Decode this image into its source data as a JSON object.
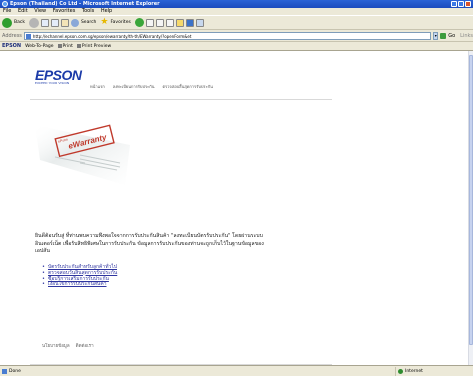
{
  "window": {
    "title": "Epson (Thailand) Co Ltd - Microsoft Internet Explorer"
  },
  "menu": [
    "File",
    "Edit",
    "View",
    "Favorites",
    "Tools",
    "Help"
  ],
  "toolbar": {
    "back_label": "Back",
    "search_label": "Search",
    "favorites_label": "Favorites"
  },
  "address": {
    "label": "Address",
    "url": "http://echannel.epson.com.sg/epson/ewarranty/th-th/EWarranty/?openForm&et",
    "go_label": "Go",
    "links_label": "Links"
  },
  "links_bar": {
    "brand": "EPSON",
    "web_to_page": "Web-To-Page",
    "print": "Print",
    "print_preview": "Print Preview"
  },
  "page": {
    "logo": "EPSON",
    "tagline": "EXCEED YOUR VISION",
    "nav": [
      "หน้าแรก",
      "ลงทะเบียนการรับประกัน",
      "ตรวจสอบสิ้นสุดการรับประกัน"
    ],
    "warranty_stamp": "ePson eWarranty",
    "intro": "ยินดีต้อนรับสู่ ที่ท่านพบความพึงพอใจจากการรับประกันสินค้า \"ลงทะเบียนบัตรรับประกัน\" โดยผ่านระบบอินเตอร์เน็ต เพื่อรับสิทธิพิเศษในการรับประกัน ข้อมูลการรับประกันของท่านจะถูกเก็บไว้ในฐานข้อมูลของเอปสัน",
    "links": [
      "บัตรรับประกันสำหรับลูกค้าทั่วไป",
      "ตรวจสอบวันสิ้นสุดการรับประกัน",
      "ซื้อบริการเสริมการรับประกัน",
      "เงื่อนไขการรับประกันสินค้า"
    ],
    "footer_nav": [
      "นโยบายข้อมูล",
      "ติดต่อเรา"
    ]
  },
  "status": {
    "text": "Done",
    "zone": "Internet"
  },
  "colors": {
    "accent": "#1b3aa8",
    "link": "#2f35a0",
    "chrome": "#ece9d8",
    "titlebar": "#2b63d6"
  }
}
